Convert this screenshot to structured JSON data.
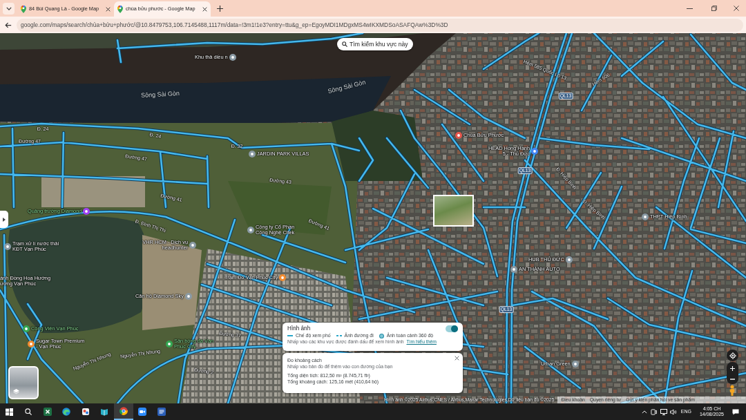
{
  "browser": {
    "tabs": [
      {
        "title": "84 Bùi Quang Là - Google Map",
        "selected": false
      },
      {
        "title": "chùa bửu phước - Google Map",
        "selected": true
      }
    ],
    "address": "google.com/maps/search/chùa+bửu+phước/@10.8479753,106.7145488,1117m/data=!3m1!1e3?entry=ttu&g_ep=EgoyMDI1MDgxMS4wIKXMDSoASAFQAw%3D%3D"
  },
  "map": {
    "search_area_button": "Tìm kiếm khu vực này",
    "labels": [
      {
        "kind": "street",
        "text": "Hẻm 585 Quốc Lộ 13"
      },
      {
        "kind": "street",
        "text": "Hẻm 606"
      },
      {
        "kind": "water",
        "text": "Sông Sài Gòn"
      },
      {
        "kind": "water",
        "text": "Sông Sài Gòn"
      },
      {
        "kind": "shield",
        "text": "QL13"
      },
      {
        "kind": "street",
        "text": "Đ. 24"
      },
      {
        "kind": "street",
        "text": "Đ. 24"
      },
      {
        "kind": "street",
        "text": "Đường 47"
      },
      {
        "kind": "street",
        "text": "Đ. 32"
      },
      {
        "kind": "street",
        "text": "Đường 47"
      },
      {
        "kind": "shield",
        "text": "QL13"
      },
      {
        "kind": "street",
        "text": "Đ. Hiệp Bình"
      },
      {
        "kind": "street",
        "text": "Đường 43"
      },
      {
        "kind": "street",
        "text": "Đường 41"
      },
      {
        "kind": "street",
        "text": "Đ. Hiệp Bình"
      },
      {
        "kind": "street",
        "text": "Đường 41"
      },
      {
        "kind": "street",
        "text": "Đ. Đinh Thị Thi"
      },
      {
        "kind": "shield",
        "text": "QL13"
      },
      {
        "kind": "street",
        "text": "Đường 37"
      },
      {
        "kind": "street",
        "text": "Nguyễn Thị Nhung"
      },
      {
        "kind": "street",
        "text": "Nguyễn Thị Nhung"
      },
      {
        "kind": "street",
        "text": "Đường 2"
      }
    ],
    "places": [
      {
        "name": "Khu thả diều n",
        "kind": "poi",
        "color": "#8a9aa4"
      },
      {
        "name": "Chùa Bửu Phước",
        "kind": "poi",
        "color": "#e5554b"
      },
      {
        "name": "JARDIN PARK VILLAS",
        "kind": "poi",
        "color": "#8a9aa4"
      },
      {
        "name": "HEAD Hồng Hạnh 5 - Thủ Đức",
        "kind": "poi",
        "color": "#4285f4"
      },
      {
        "name": "Quảng trường Diamond",
        "kind": "park",
        "color": "#a142f4"
      },
      {
        "name": "THPT Hiệp Bình",
        "kind": "poi",
        "color": "#8a9aa4"
      },
      {
        "name": "Công ty Cổ Phần Công Nghệ Citek",
        "kind": "poi",
        "color": "#8a9aa4"
      },
      {
        "name": "Trạm xử lí nước thải KĐT Vạn Phúc",
        "kind": "poi",
        "color": "#8a9aa4"
      },
      {
        "name": "VHR HCM - Dịch vụ headhunter",
        "kind": "poi",
        "color": "#8a9aa4"
      },
      {
        "name": "HUB THỦ ĐỨC",
        "kind": "poi",
        "color": "#8a9aa4"
      },
      {
        "name": "AN THÀNH AUTO",
        "kind": "poi",
        "color": "#8a9aa4"
      },
      {
        "name": "ánh Đồng Hoa Hướng ương Vạn Phúc",
        "kind": "poi"
      },
      {
        "name": "Trạm Đo Vạn Phúc City",
        "kind": "poi",
        "color": "#f28b30"
      },
      {
        "name": "Căn hộ Diamond Sky",
        "kind": "poi",
        "color": "#8a9aa4"
      },
      {
        "name": "Công Viên Vạn Phúc",
        "kind": "park",
        "color": "#34a853"
      },
      {
        "name": "Sugar Town Premium - Vạn Phúc",
        "kind": "poi",
        "color": "#f28b30"
      },
      {
        "name": "Sân bóng đá Vạn Phúc City",
        "kind": "park",
        "color": "#34a853"
      },
      {
        "name": "Urban Green",
        "kind": "poi",
        "color": "#8a9aa4"
      }
    ],
    "imagery_panel": {
      "title": "Hình ảnh",
      "on": true,
      "legend": [
        {
          "kind": "solid",
          "text": "Chế độ xem phố"
        },
        {
          "kind": "dashed",
          "text": "Ảnh đường đi"
        },
        {
          "kind": "dot",
          "text": "Ảnh toàn cảnh 360 độ"
        }
      ],
      "hint": "Nhấp vào các khu vực được đánh dấu để xem hình ảnh",
      "link": "Tìm hiểu thêm"
    },
    "measure_panel": {
      "title": "Đo khoảng cách",
      "hint": "Nhấp vào bản đồ để thêm vào con đường của bạn",
      "area": "Tổng diện tích: 812,50 m² (8.745,71 ft²)",
      "distance": "Tổng khoảng cách: 125,16 mét (410,64 bộ)"
    },
    "attribution": {
      "imagery": "Hình ảnh ©2025 Airbus,CNES / Airbus,Maxar Technologies,Dữ liệu bản đồ ©2025",
      "links": [
        "Điều khoản",
        "Quyền riêng tư",
        "Gửi ý kiến phản hồi về sản phẩm"
      ]
    }
  },
  "taskbar": {
    "apps": [
      {
        "kind": "sheet",
        "selected": false
      },
      {
        "kind": "wave",
        "selected": false
      },
      {
        "kind": "tool",
        "selected": false
      },
      {
        "kind": "book",
        "selected": false
      },
      {
        "kind": "browser",
        "selected": true
      },
      {
        "kind": "video",
        "selected": false
      },
      {
        "kind": "doc",
        "selected": false
      }
    ],
    "language": "ENG",
    "time": "4:05 CH",
    "date": "14/08/2025"
  }
}
